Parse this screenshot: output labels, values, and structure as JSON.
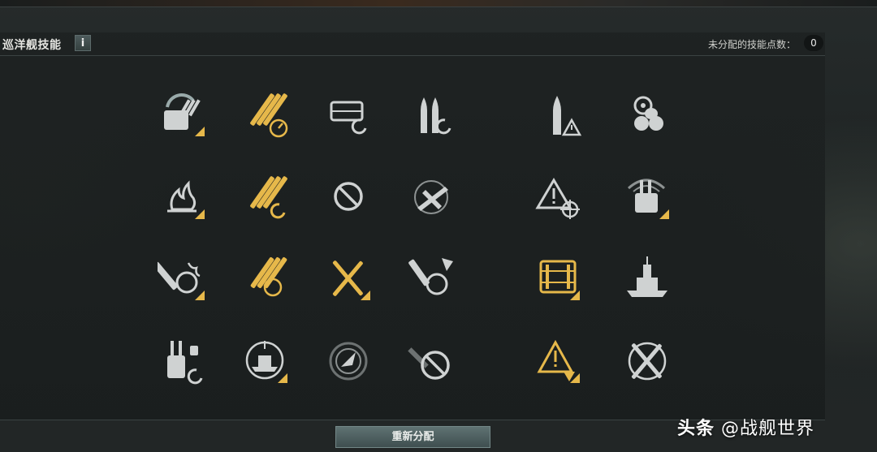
{
  "header": {
    "title": "巡洋舰技能",
    "info_label": "i",
    "points_label": "未分配的技能点数：",
    "points_value": "0"
  },
  "skills": [
    {
      "icon": "turret-traverse-icon",
      "active": false
    },
    {
      "icon": "main-battery-reload-speed-icon",
      "active": true
    },
    {
      "icon": "consumable-reload-icon",
      "active": false
    },
    {
      "icon": "shell-reload-icon",
      "active": false
    },
    {
      "icon": "high-explosive-shell-warning-icon",
      "active": false
    },
    {
      "icon": "steering-propulsion-icon",
      "active": false
    },
    {
      "icon": "fire-icon",
      "active": false
    },
    {
      "icon": "main-battery-reload-icon",
      "active": true
    },
    {
      "icon": "prohibited-icon",
      "active": false
    },
    {
      "icon": "aircraft-icon",
      "active": false
    },
    {
      "icon": "danger-targeting-icon",
      "active": false
    },
    {
      "icon": "radar-turret-icon",
      "active": false
    },
    {
      "icon": "fire-turret-icon",
      "active": false
    },
    {
      "icon": "main-battery-turret-icon",
      "active": true
    },
    {
      "icon": "crossed-guns-icon",
      "active": true
    },
    {
      "icon": "shell-turret-icon",
      "active": false
    },
    {
      "icon": "ammo-crate-icon",
      "active": true
    },
    {
      "icon": "battleship-icon",
      "active": false
    },
    {
      "icon": "secondary-battery-reload-icon",
      "active": false
    },
    {
      "icon": "ship-targeting-icon",
      "active": false
    },
    {
      "icon": "radar-sweep-icon",
      "active": false
    },
    {
      "icon": "prohibited-aircraft-icon",
      "active": false
    },
    {
      "icon": "danger-down-icon",
      "active": true
    },
    {
      "icon": "crossed-targeting-icon",
      "active": false
    }
  ],
  "reset_button": "重新分配",
  "watermark": {
    "prefix": "头条",
    "text": "@战舰世界"
  },
  "colors": {
    "active": "#e6b84a",
    "inactive": "#c9cccc",
    "accent_corner": "#e6b84a"
  }
}
